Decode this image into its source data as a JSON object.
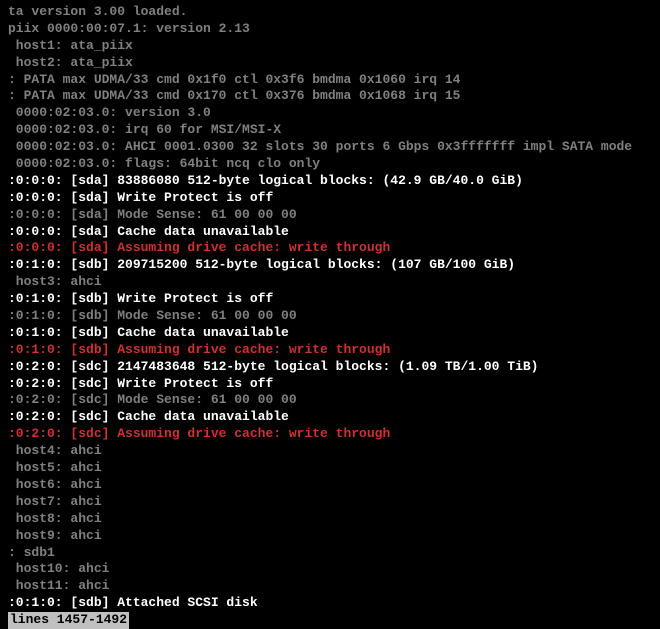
{
  "lines": [
    {
      "segments": [
        {
          "text": "ta version 3.00 loaded.",
          "class": "gray"
        }
      ]
    },
    {
      "segments": [
        {
          "text": "piix 0000:00:07.1: version 2.13",
          "class": "gray"
        }
      ]
    },
    {
      "segments": [
        {
          "text": " host1: ata_piix",
          "class": "gray"
        }
      ]
    },
    {
      "segments": [
        {
          "text": " host2: ata_piix",
          "class": "gray"
        }
      ]
    },
    {
      "segments": [
        {
          "text": ": PATA max UDMA/33 cmd 0x1f0 ctl 0x3f6 bmdma 0x1060 irq 14",
          "class": "gray"
        }
      ]
    },
    {
      "segments": [
        {
          "text": ": PATA max UDMA/33 cmd 0x170 ctl 0x376 bmdma 0x1068 irq 15",
          "class": "gray"
        }
      ]
    },
    {
      "segments": [
        {
          "text": " 0000:02:03.0: version 3.0",
          "class": "gray"
        }
      ]
    },
    {
      "segments": [
        {
          "text": " 0000:02:03.0: irq 60 for MSI/MSI-X",
          "class": "gray"
        }
      ]
    },
    {
      "segments": [
        {
          "text": " 0000:02:03.0: AHCI 0001.0300 32 slots 30 ports 6 Gbps 0x3fffffff impl SATA mode",
          "class": "gray"
        }
      ]
    },
    {
      "segments": [
        {
          "text": " 0000:02:03.0: flags: 64bit ncq clo only",
          "class": "gray"
        }
      ]
    },
    {
      "segments": [
        {
          "text": ":0:0:0: [sda] 83886080 512-byte logical blocks: (42.9 GB/40.0 GiB)",
          "class": "white"
        }
      ]
    },
    {
      "segments": [
        {
          "text": ":0:0:0: [sda] Write Protect is off",
          "class": "white"
        }
      ]
    },
    {
      "segments": [
        {
          "text": ":0:0:0: [sda] Mode Sense: 61 00 00 00",
          "class": "gray"
        }
      ]
    },
    {
      "segments": [
        {
          "text": ":0:0:0: [sda] Cache data unavailable",
          "class": "white"
        }
      ]
    },
    {
      "segments": [
        {
          "text": ":0:0:0: [sda] Assuming drive cache: write through",
          "class": "red"
        }
      ]
    },
    {
      "segments": [
        {
          "text": ":0:1:0: [sdb] 209715200 512-byte logical blocks: (107 GB/100 GiB)",
          "class": "white"
        }
      ]
    },
    {
      "segments": [
        {
          "text": " host3: ahci",
          "class": "gray"
        }
      ]
    },
    {
      "segments": [
        {
          "text": ":0:1:0: [sdb] Write Protect is off",
          "class": "white"
        }
      ]
    },
    {
      "segments": [
        {
          "text": ":0:1:0: [sdb] Mode Sense: 61 00 00 00",
          "class": "gray"
        }
      ]
    },
    {
      "segments": [
        {
          "text": ":0:1:0: [sdb] Cache data unavailable",
          "class": "white"
        }
      ]
    },
    {
      "segments": [
        {
          "text": ":0:1:0: [sdb] Assuming drive cache: write through",
          "class": "red"
        }
      ]
    },
    {
      "segments": [
        {
          "text": ":0:2:0: [sdc] 2147483648 512-byte logical blocks: (1.09 TB/1.00 TiB)",
          "class": "white"
        }
      ]
    },
    {
      "segments": [
        {
          "text": ":0:2:0: [sdc] Write Protect is off",
          "class": "white"
        }
      ]
    },
    {
      "segments": [
        {
          "text": ":0:2:0: [sdc] Mode Sense: 61 00 00 00",
          "class": "gray"
        }
      ]
    },
    {
      "segments": [
        {
          "text": ":0:2:0: [sdc] Cache data unavailable",
          "class": "white"
        }
      ]
    },
    {
      "segments": [
        {
          "text": ":0:2:0: [sdc] Assuming drive cache: write through",
          "class": "red"
        }
      ]
    },
    {
      "segments": [
        {
          "text": " host4: ahci",
          "class": "gray"
        }
      ]
    },
    {
      "segments": [
        {
          "text": " host5: ahci",
          "class": "gray"
        }
      ]
    },
    {
      "segments": [
        {
          "text": " host6: ahci",
          "class": "gray"
        }
      ]
    },
    {
      "segments": [
        {
          "text": " host7: ahci",
          "class": "gray"
        }
      ]
    },
    {
      "segments": [
        {
          "text": " host8: ahci",
          "class": "gray"
        }
      ]
    },
    {
      "segments": [
        {
          "text": " host9: ahci",
          "class": "gray"
        }
      ]
    },
    {
      "segments": [
        {
          "text": ": sdb1",
          "class": "gray"
        }
      ]
    },
    {
      "segments": [
        {
          "text": " host10: ahci",
          "class": "gray"
        }
      ]
    },
    {
      "segments": [
        {
          "text": " host11: ahci",
          "class": "gray"
        }
      ]
    },
    {
      "segments": [
        {
          "text": ":0:1:0: [sdb] Attached SCSI disk",
          "class": "white"
        }
      ]
    }
  ],
  "status_bar": "lines 1457-1492"
}
